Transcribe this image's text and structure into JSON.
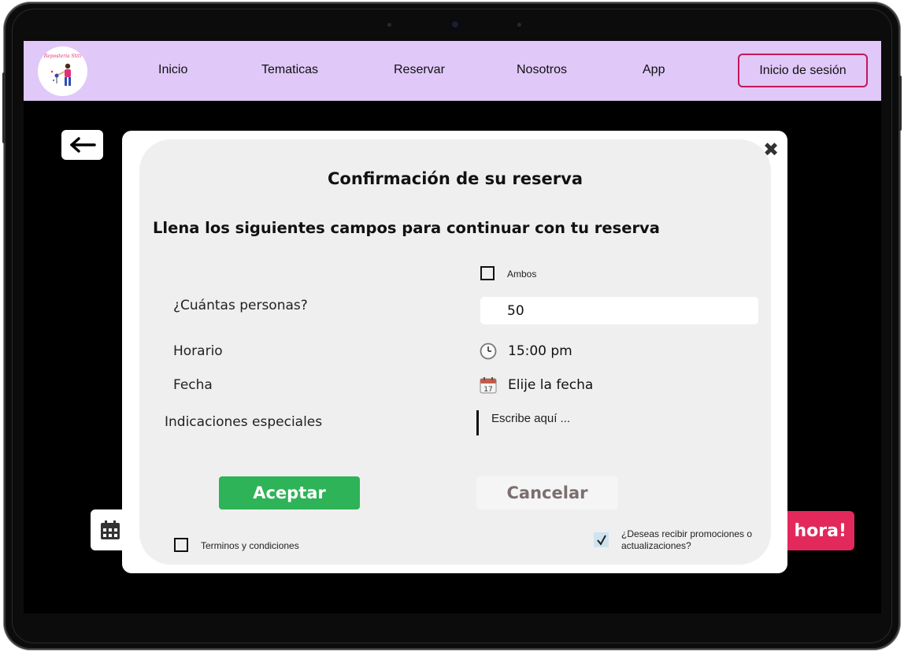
{
  "nav": {
    "logo_text": "Reposteria Stiti",
    "links": [
      "Inicio",
      "Tematicas",
      "Reservar",
      "Nosotros",
      "App"
    ],
    "login_label": "Inicio de sesión"
  },
  "page": {
    "back_icon": "arrow-left-icon",
    "calendar_icon": "calendar-icon",
    "now_button_label": "hora!"
  },
  "modal": {
    "title": "Confirmación de su reserva",
    "subtitle": "Llena los siguientes campos para continuar con tu reserva",
    "both_label": "Ambos",
    "both_checked": false,
    "people_label": "¿Cuántas personas?",
    "people_value": "50",
    "schedule_label": "Horario",
    "schedule_value": "15:00 pm",
    "schedule_icon": "clock-icon",
    "date_label": "Fecha",
    "date_value": "Elije la fecha",
    "date_icon": "calendar-17-icon",
    "date_icon_day": "17",
    "notes_label": "Indicaciones especiales",
    "notes_placeholder": "Escribe aquí ...",
    "accept_label": "Aceptar",
    "cancel_label": "Cancelar",
    "terms_label": "Terminos y condiciones",
    "terms_checked": false,
    "promo_label": "¿Deseas recibir promociones o actualizaciones?",
    "promo_checked": true,
    "colors": {
      "accept": "#2eb358",
      "nav_bg": "#e0c8f8",
      "login_border": "#c2185b",
      "now_button": "#e3295c"
    }
  }
}
